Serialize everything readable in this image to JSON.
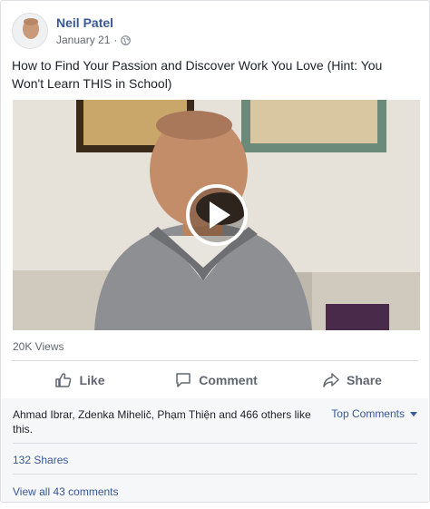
{
  "post": {
    "author": "Neil Patel",
    "date": "January 21",
    "date_separator": "·",
    "privacy_icon": "globe-icon",
    "text": "How to Find Your Passion and Discover Work You Love (Hint: You Won't Learn THIS in School)"
  },
  "video": {
    "play_icon": "play-icon",
    "views": "20K Views"
  },
  "actions": {
    "like": "Like",
    "comment": "Comment",
    "share": "Share"
  },
  "footer": {
    "likes_summary": "Ahmad Ibrar, Zdenka Mihelič, Phạm Thiện and 466 others like this.",
    "sort_label": "Top Comments",
    "shares": "132 Shares",
    "view_comments": "View all 43 comments"
  },
  "colors": {
    "link": "#385898",
    "secondary_text": "#616770",
    "footer_bg": "#f6f7f9",
    "border": "#dddfe2"
  }
}
